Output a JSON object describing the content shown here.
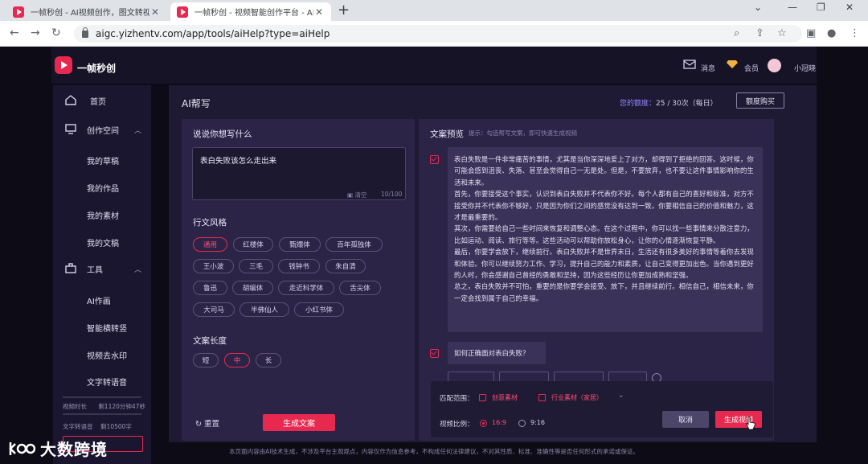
{
  "browser": {
    "tabs": [
      {
        "label": "一帧秒创 - AI视频创作，图文转视频"
      },
      {
        "label": "一帧秒创 - 视频智能创作平台 - AI"
      }
    ],
    "url": "aigc.yizhentv.com/app/tools/aiHelp?type=aiHelp"
  },
  "header": {
    "brand": "一帧秒创",
    "messages": "消息",
    "member": "会员",
    "username": "小冠晓"
  },
  "sidebar": {
    "items": [
      {
        "label": "首页"
      },
      {
        "label": "创作空间"
      },
      {
        "label": "我的草稿"
      },
      {
        "label": "我的作品"
      },
      {
        "label": "我的素材"
      },
      {
        "label": "我的文稿"
      },
      {
        "label": "工具"
      },
      {
        "label": "AI作画"
      },
      {
        "label": "智能横转竖"
      },
      {
        "label": "视频去水印"
      },
      {
        "label": "文字转语音"
      }
    ],
    "stats": [
      {
        "label": "视频时长",
        "value": "剩1120分钟47秒"
      },
      {
        "label": "文字转语音",
        "value": "剩10500字"
      }
    ]
  },
  "main": {
    "title": "AI帮写",
    "quota_label": "您的额度：",
    "quota_value": "25 / 30次（每日）",
    "buy_button": "额度购买"
  },
  "form": {
    "prompt_title": "说说你想写什么",
    "prompt_value": "表白失败该怎么走出来",
    "clear_label": "清空",
    "char_count": "10/100",
    "style_title": "行文风格",
    "styles": [
      {
        "label": "通用",
        "selected": true
      },
      {
        "label": "红楼体"
      },
      {
        "label": "甄嬛体"
      },
      {
        "label": "百年孤独体"
      },
      {
        "label": "王小波"
      },
      {
        "label": "三毛"
      },
      {
        "label": "钱钟书"
      },
      {
        "label": "朱自清"
      },
      {
        "label": "鲁迅"
      },
      {
        "label": "胡编体"
      },
      {
        "label": "走近科学体"
      },
      {
        "label": "舌尖体"
      },
      {
        "label": "大司马"
      },
      {
        "label": "半佛仙人"
      },
      {
        "label": "小红书体"
      }
    ],
    "length_title": "文案长度",
    "lengths": [
      {
        "label": "短"
      },
      {
        "label": "中",
        "selected": true
      },
      {
        "label": "长"
      }
    ],
    "reset_label": "重置",
    "generate_button": "生成文案"
  },
  "preview": {
    "title": "文案预览",
    "hint": "提示：勾选帮写文案，即可快速生成视频",
    "paragraphs": [
      "表白失败是一件非常痛苦的事情，尤其是当你深深地爱上了对方，却得到了拒绝的回答。这时候，你可能会感到沮丧、失落、甚至会觉得自己一无是处。但是，不要放弃，也不要让这件事情影响你的生活和未来。",
      "首先，你要接受这个事实，认识到表白失败并不代表你不好。每个人都有自己的喜好和标准，对方不接受你并不代表你不够好，只是因为你们之间的感觉没有达到一致。你要相信自己的价值和魅力，这才是最重要的。",
      "其次，你需要给自己一些时间来恢复和调整心态。在这个过程中，你可以找一些事情来分散注意力，比如运动、阅读、旅行等等。这些活动可以帮助你放松身心，让你的心情逐渐恢复平静。",
      "最后，你要学会放下，继续前行。表白失败并不是世界末日，生活还有很多美好的事情等着你去发现和体验。你可以继续努力工作、学习，提升自己的能力和素质，让自己变得更加出色。当你遇到更好的人时，你会感谢自己曾经的勇敢和坚持，因为这些经历让你更加成熟和坚强。",
      "总之，表白失败并不可怕，重要的是你要学会接受、放下，并且继续前行。相信自己，相信未来，你一定会找到属于自己的幸福。"
    ],
    "question": "如何正确面对表白失败？"
  },
  "generate_panel": {
    "match_label": "匹配范围：",
    "match_opts": [
      {
        "label": "创意素材"
      },
      {
        "label": "行业素材（家居）"
      }
    ],
    "ratio_label": "视频比例：",
    "ratios": [
      {
        "label": "16:9",
        "selected": true
      },
      {
        "label": "9:16"
      }
    ],
    "cancel_button": "取消",
    "confirm_button": "生成视频"
  },
  "footer": {
    "disclaimer": "本页面内容由AI技术生成，不涉及平台主观观点，内容仅作为信息参考，不构成任何法律建议，不对其性质、标准、准确性等是否任何形式的承诺或保证。"
  },
  "watermark": {
    "text": "大数跨境"
  },
  "colors": {
    "accent": "#e8294f",
    "quota": "#8e87ff",
    "panel": "#2b2447"
  }
}
